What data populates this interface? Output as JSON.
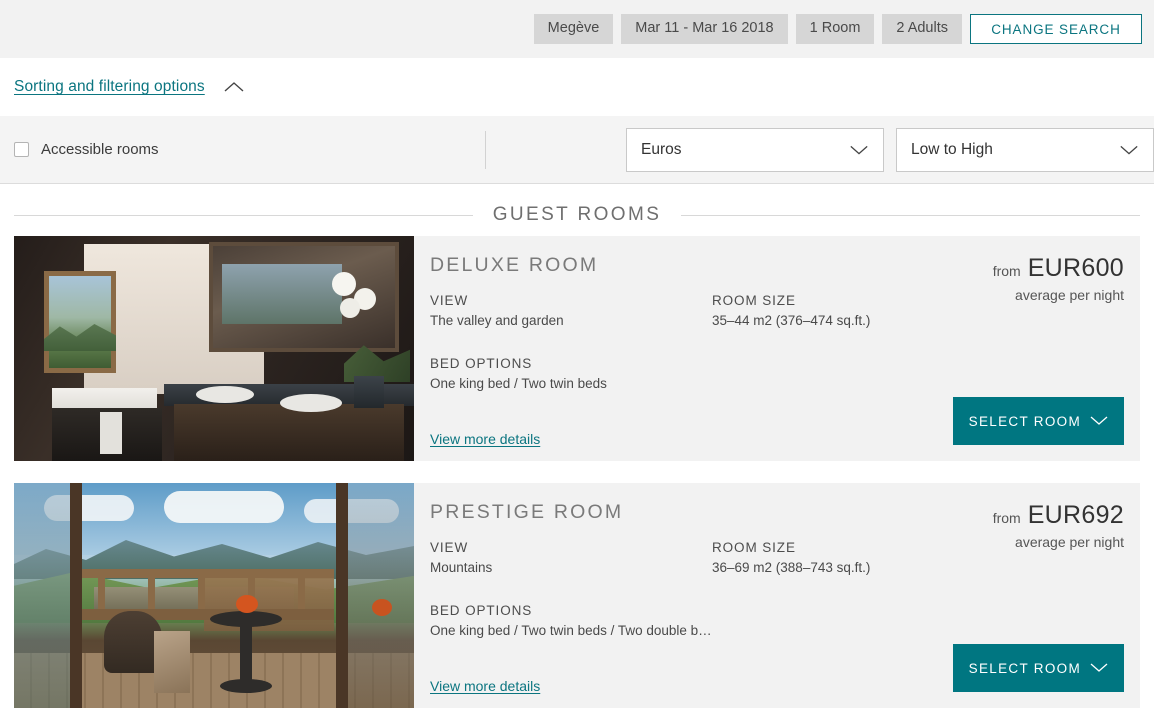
{
  "search_bar": {
    "pills": [
      {
        "name": "destination",
        "label": "Megève"
      },
      {
        "name": "dates",
        "label": "Mar 11 - Mar 16 2018"
      },
      {
        "name": "rooms",
        "label": "1 Room"
      },
      {
        "name": "guests",
        "label": "2 Adults"
      }
    ],
    "change_search_label": "CHANGE SEARCH"
  },
  "sorting": {
    "link_label": "Sorting and filtering options",
    "toggle_icon": "chevron-up-icon",
    "accessible_rooms_label": "Accessible rooms",
    "accessible_rooms_checked": false,
    "currency_select": {
      "value": "Euros",
      "icon": "chevron-down-icon"
    },
    "sort_select": {
      "value": "Low to High",
      "icon": "chevron-down-icon"
    }
  },
  "section": {
    "title": "GUEST ROOMS"
  },
  "labels": {
    "view": "VIEW",
    "room_size": "ROOM SIZE",
    "bed_options": "BED OPTIONS",
    "view_more_details": "View more details",
    "select_room": "SELECT ROOM",
    "price_from": "from",
    "price_sub": "average per night"
  },
  "rooms": [
    {
      "name": "DELUXE ROOM",
      "view": "The valley and garden",
      "room_size": "35–44 m2 (376–474 sq.ft.)",
      "bed_options": "One king bed / Two twin beds",
      "price": "EUR600",
      "photo_alt": "deluxe-room-bathroom-photo"
    },
    {
      "name": "PRESTIGE ROOM",
      "view": "Mountains",
      "room_size": "36–69 m2 (388–743 sq.ft.)",
      "bed_options": "One king bed / Two twin beds / Two double b…",
      "price": "EUR692",
      "photo_alt": "prestige-room-balcony-photo"
    }
  ],
  "colors": {
    "accent_teal": "#007681",
    "link_teal": "#0b7580",
    "pill_gray": "#d6d6d6",
    "card_bg": "#f2f2f2"
  }
}
